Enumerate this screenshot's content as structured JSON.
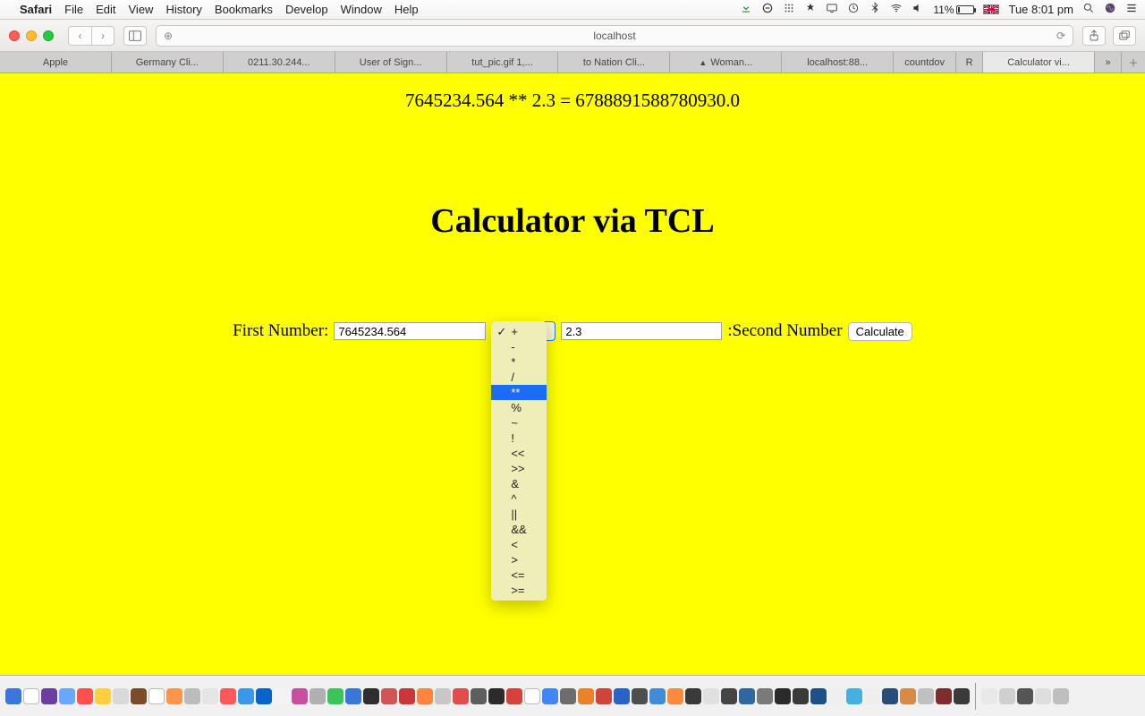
{
  "menubar": {
    "app": "Safari",
    "items": [
      "File",
      "Edit",
      "View",
      "History",
      "Bookmarks",
      "Develop",
      "Window",
      "Help"
    ],
    "battery_pct": "11%",
    "clock": "Tue 8:01 pm"
  },
  "browser": {
    "url_display": "localhost",
    "tabs": [
      {
        "label": "Apple"
      },
      {
        "label": "Germany Cli..."
      },
      {
        "label": "0211.30.244..."
      },
      {
        "label": "User of Sign..."
      },
      {
        "label": "tut_pic.gif 1,..."
      },
      {
        "label": "to Nation Cli..."
      },
      {
        "label": "Woman..."
      },
      {
        "label": "localhost:88..."
      },
      {
        "label": "countdov"
      },
      {
        "label": "R"
      },
      {
        "label": "Calculator vi...",
        "active": true
      }
    ]
  },
  "page": {
    "result_line": "7645234.564 ** 2.3 = 6788891588780930.0",
    "heading": "Calculator via TCL",
    "label_first": "First Number:",
    "label_second": ":Second Number",
    "input_first": "7645234.564",
    "input_second": "2.3",
    "calculate_label": "Calculate",
    "operator_checked": "+",
    "operator_highlight": "**",
    "operator_options": [
      "+",
      "-",
      "*",
      "/",
      "**",
      "%",
      "~",
      "!",
      "<<",
      ">>",
      "&",
      "^",
      "||",
      "&&",
      "<",
      ">",
      "<=",
      ">="
    ]
  }
}
